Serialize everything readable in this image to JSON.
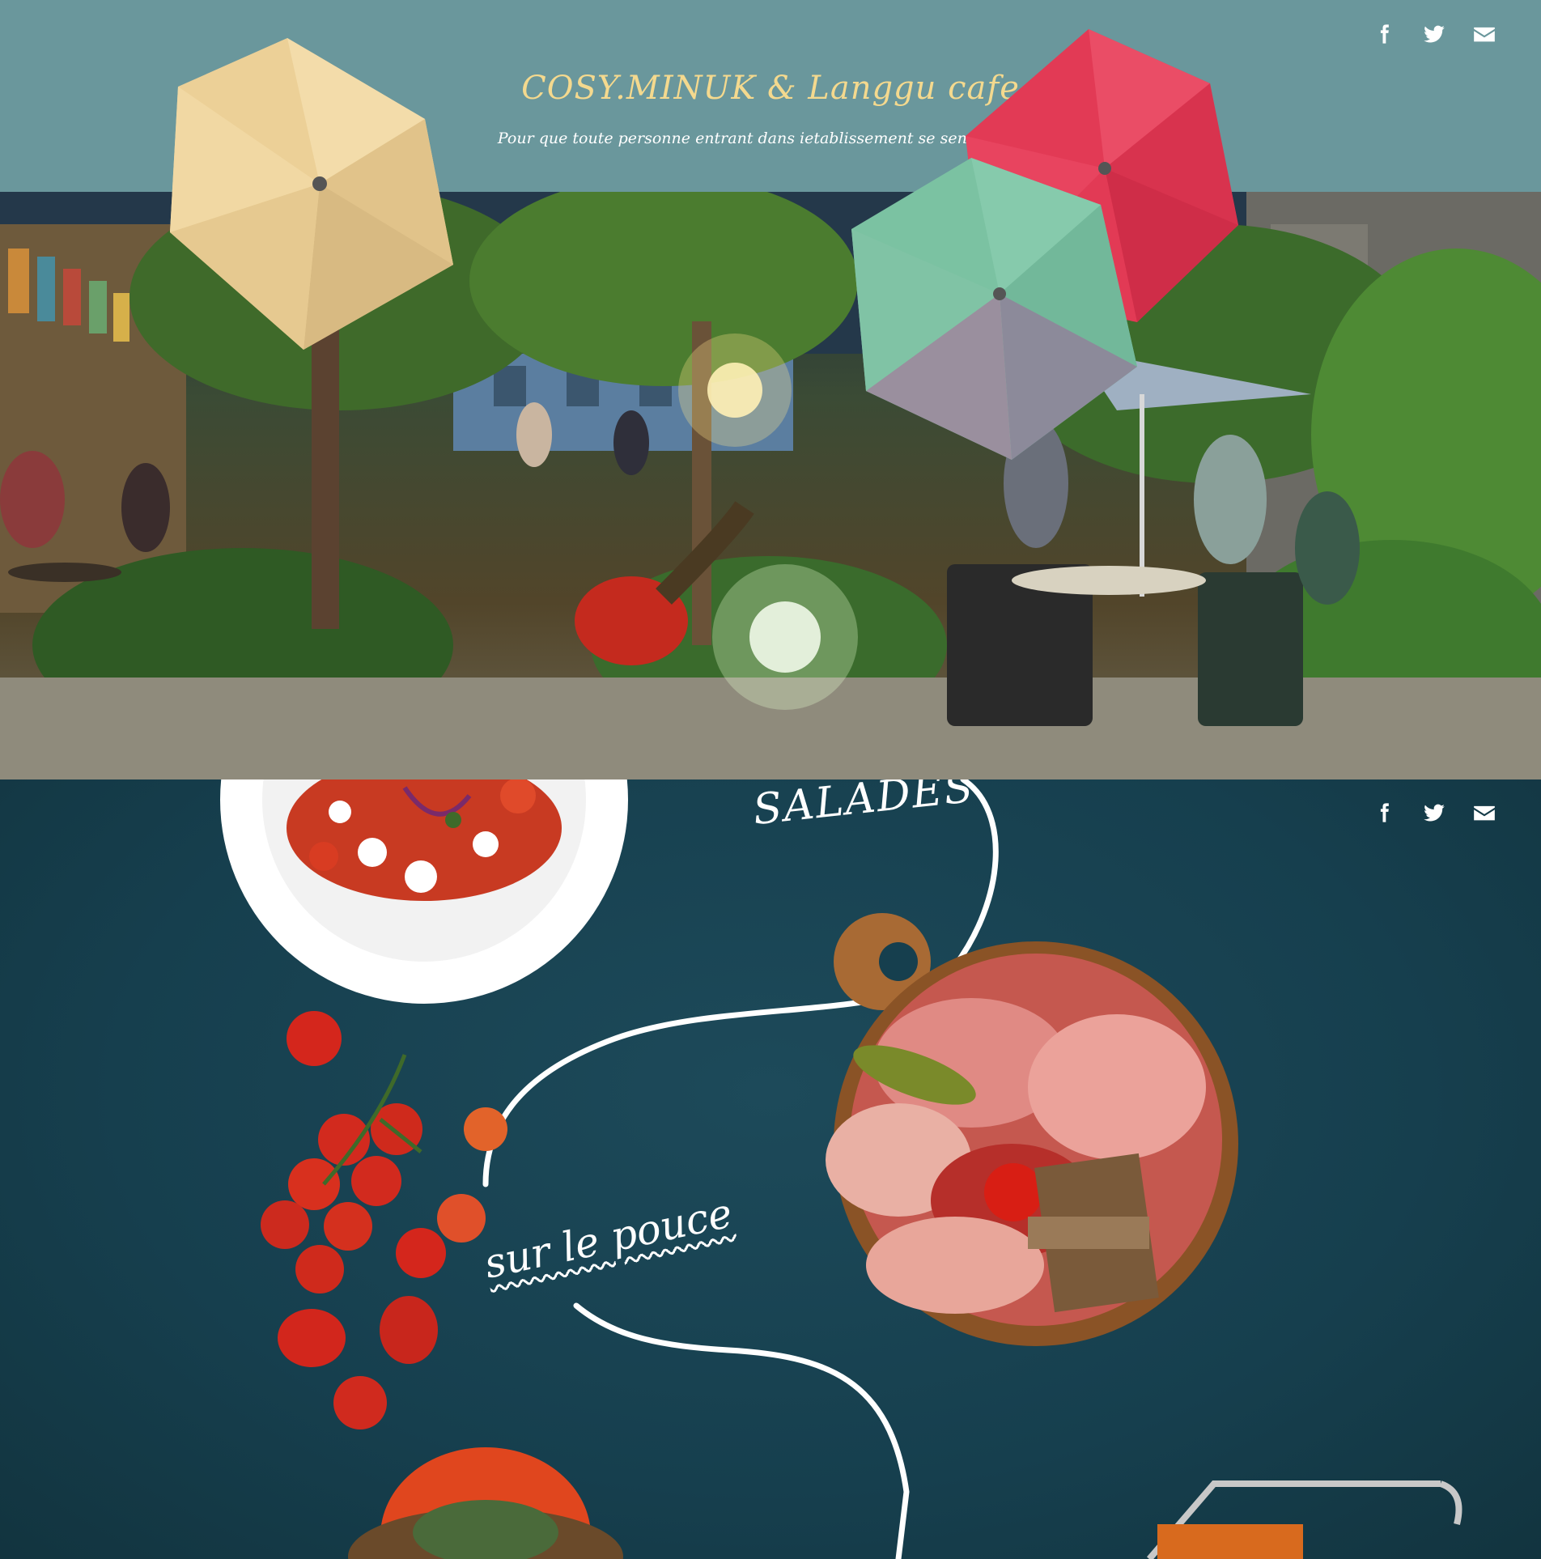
{
  "site": {
    "title": "COSY.MINUK & Langgu cafe",
    "tagline": "Pour que toute personne entrant dans ietablissement se sente comme"
  },
  "social_icons": [
    "facebook-icon",
    "twitter-icon",
    "envelope-icon"
  ],
  "menu_sections": {
    "salades": "SALADES",
    "sur_le_pouce": "sur le pouce"
  },
  "colors": {
    "header_bg": "#6a979c",
    "title": "#f4d98e",
    "menu_bg": "#163f4e",
    "umbrella_beige": "#f0d49a",
    "umbrella_red": "#e23a55",
    "umbrella_green": "#79c1a1"
  }
}
